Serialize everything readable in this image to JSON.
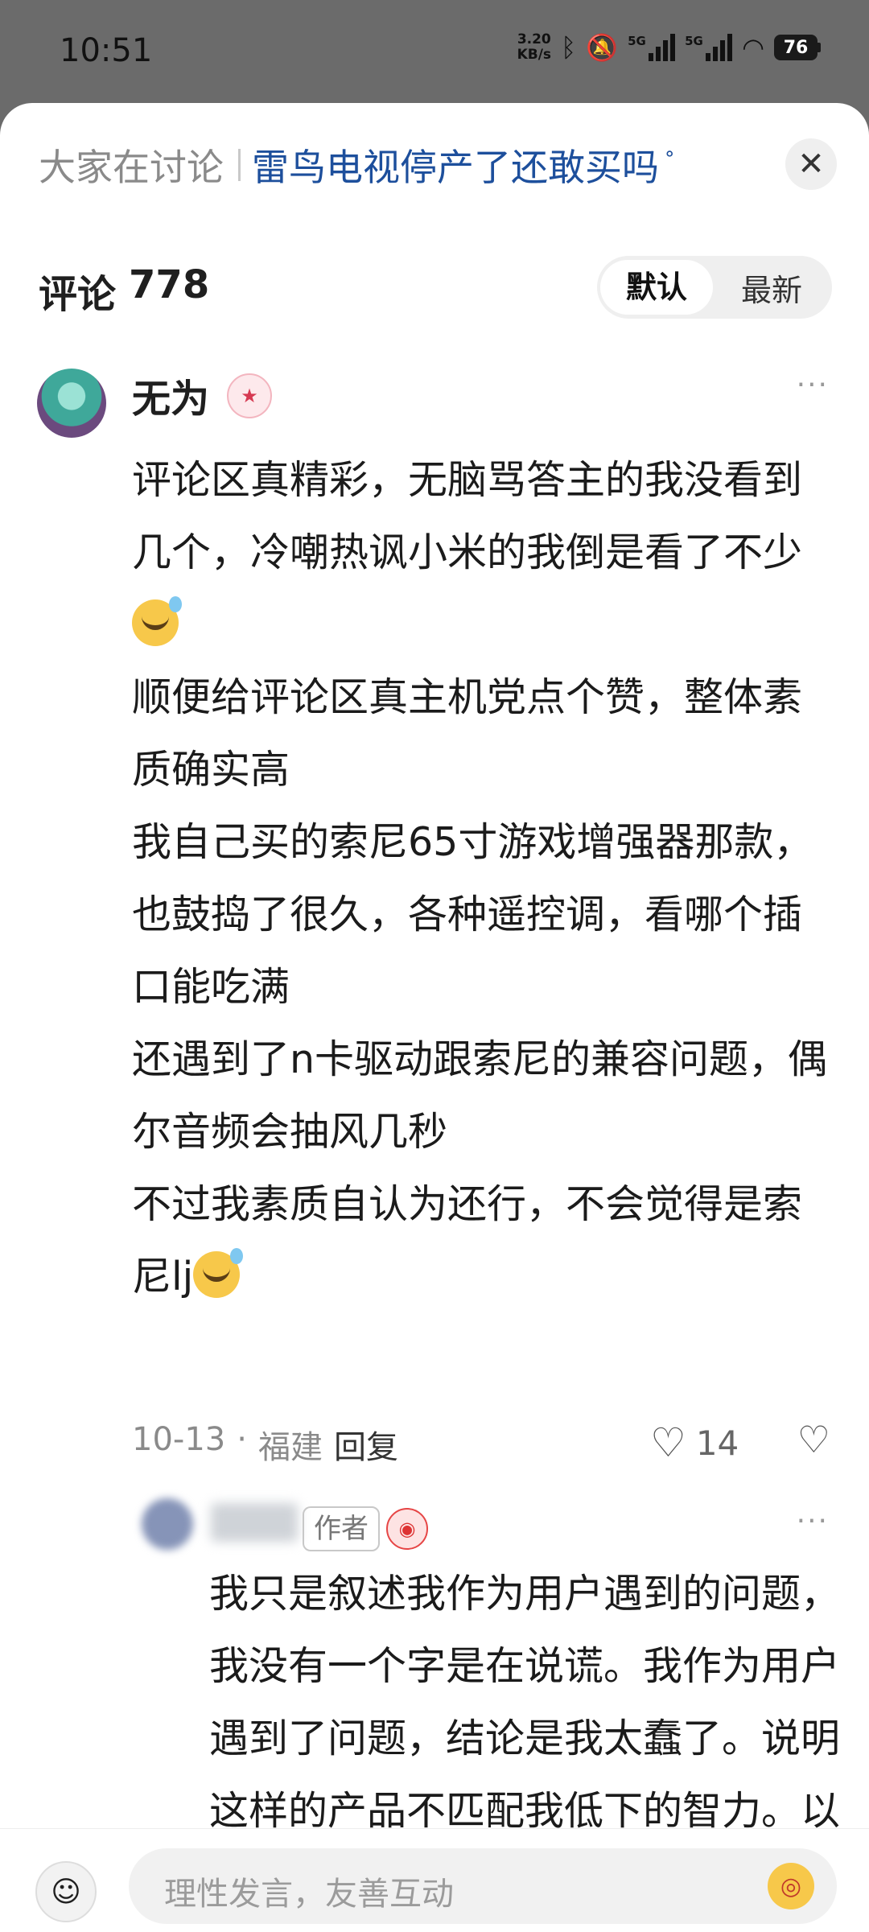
{
  "status_bar": {
    "time": "10:51",
    "net_speed_value": "3.20",
    "net_speed_unit": "KB/s",
    "signal1": "5G",
    "signal2": "5G",
    "battery": "76",
    "icons": [
      "bluetooth-icon",
      "mute-icon",
      "signal-icon",
      "wifi-icon",
      "battery-icon"
    ]
  },
  "topic": {
    "prefix": "大家在讨论",
    "title": "雷鸟电视停产了还敢买吗"
  },
  "comments_header": {
    "label": "评论",
    "count": "778",
    "sort_options": [
      "默认",
      "最新"
    ],
    "active_sort": "默认"
  },
  "comment": {
    "username": "无为",
    "paragraphs": [
      "评论区真精彩，无脑骂答主的我没看到几个，冷嘲热讽小米的我倒是看了不少",
      "顺便给评论区真主机党点个赞，整体素质确实高",
      "我自己买的索尼65寸游戏增强器那款，也鼓捣了很久，各种遥控调，看哪个插口能吃满",
      "还遇到了n卡驱动跟索尼的兼容问题，偶尔音频会抽风几秒",
      "不过我素质自认为还行，不会觉得是索尼lj"
    ],
    "date": "10-13",
    "location": "福建",
    "reply_label": "回复",
    "likes": "14"
  },
  "reply": {
    "author_tag": "作者",
    "text": "我只是叙述我作为用户遇到的问题，我没有一个字是在说谎。我作为用户遇到了问题，结论是我太蠢了。说明这样的产品不匹配我低下的智力。以我这样低下的智"
  },
  "input_bar": {
    "placeholder": "理性发言，友善互动"
  },
  "colors": {
    "topic_title": "#1d4f9c",
    "overlay": "#6b6b6b"
  }
}
